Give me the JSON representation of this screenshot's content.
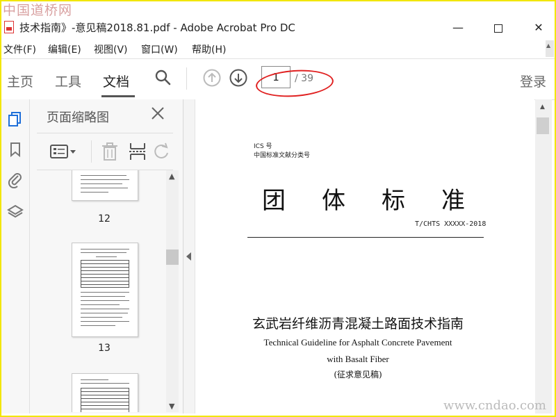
{
  "watermarks": {
    "top": "中国道桥网",
    "bottom": "www.cndao.com"
  },
  "window": {
    "title": "技术指南》-意见稿2018.81.pdf - Adobe Acrobat Pro DC",
    "minimize": "—",
    "close": "✕"
  },
  "menu": [
    "文件(F)",
    "编辑(E)",
    "视图(V)",
    "窗口(W)",
    "帮助(H)"
  ],
  "toolbar": {
    "tabs": [
      "主页",
      "工具",
      "文档"
    ],
    "active_tab": "文档",
    "page_current": "1",
    "page_total": "/ 39",
    "login": "登录"
  },
  "sidebar": {
    "icons": [
      "pages-icon",
      "bookmark-icon",
      "attachment-icon",
      "layers-icon"
    ],
    "panel_title": "页面缩略图",
    "thumbnails": [
      {
        "label": "12"
      },
      {
        "label": "13"
      }
    ]
  },
  "document": {
    "ics": "ICS 号",
    "classification": "中国标准文献分类号",
    "big_title": "团体标准",
    "code": "T/CHTS XXXXX-2018",
    "cn_title": "玄武岩纤维沥青混凝土路面技术指南",
    "en_title_line1": "Technical Guideline for Asphalt Concrete Pavement",
    "en_title_line2": "with Basalt Fiber",
    "draft_note": "(征求意见稿)"
  },
  "colors": {
    "frame": "#f2e600",
    "highlight_ellipse": "#e02020"
  }
}
